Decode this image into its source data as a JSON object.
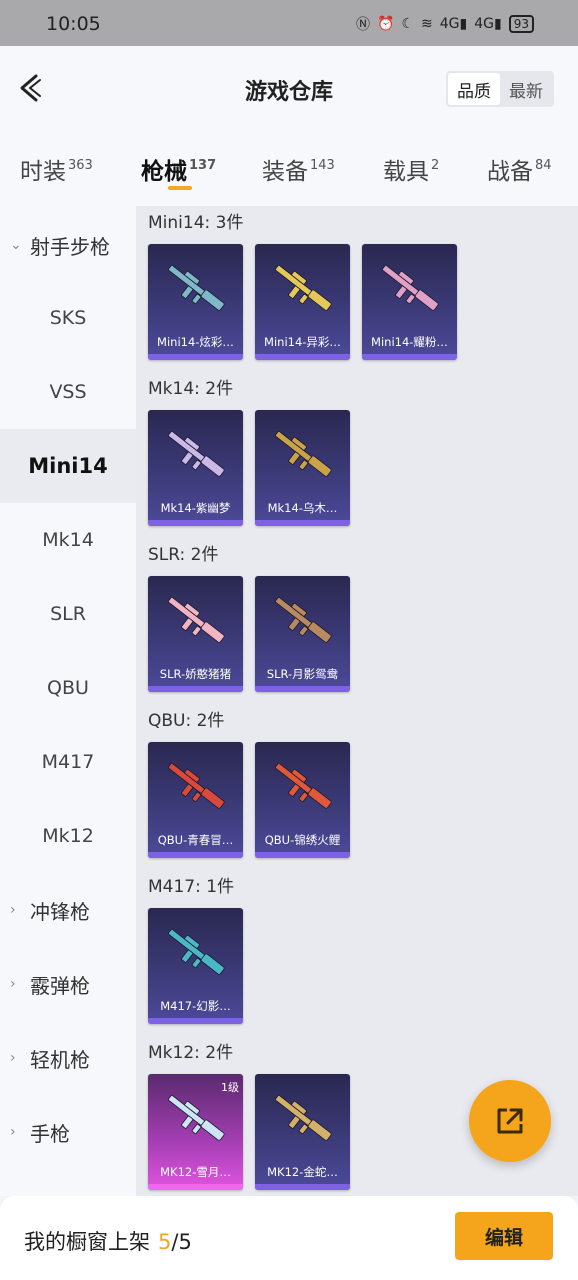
{
  "status_bar": {
    "time": "10:05",
    "network": "4G",
    "battery": "93"
  },
  "header": {
    "title": "游戏仓库",
    "sort_options": [
      "品质",
      "最新"
    ],
    "active_sort": "品质"
  },
  "tabs": [
    {
      "label": "时装",
      "count": "363"
    },
    {
      "label": "枪械",
      "count": "137",
      "active": true
    },
    {
      "label": "装备",
      "count": "143"
    },
    {
      "label": "载具",
      "count": "2"
    },
    {
      "label": "战备",
      "count": "84"
    }
  ],
  "sidebar": {
    "category_expanded": "射手步枪",
    "items": [
      "SKS",
      "VSS",
      "Mini14",
      "Mk14",
      "SLR",
      "QBU",
      "M417",
      "Mk12"
    ],
    "active_item": "Mini14",
    "collapsed_categories": [
      "冲锋枪",
      "霰弹枪",
      "轻机枪",
      "手枪"
    ]
  },
  "groups": [
    {
      "title": "Mini14: 3件",
      "items": [
        {
          "label": "Mini14-炫彩…",
          "color": "#7fb8c9"
        },
        {
          "label": "Mini14-异彩…",
          "color": "#e4c95a"
        },
        {
          "label": "Mini14-耀粉…",
          "color": "#e1a0c8"
        }
      ]
    },
    {
      "title": "Mk14: 2件",
      "items": [
        {
          "label": "Mk14-紫幽梦",
          "color": "#c9b8e8"
        },
        {
          "label": "Mk14-乌木…",
          "color": "#caa24a"
        }
      ]
    },
    {
      "title": "SLR: 2件",
      "items": [
        {
          "label": "SLR-娇憨猪猪",
          "color": "#f1b4c4"
        },
        {
          "label": "SLR-月影鸳鸯",
          "color": "#b88a62"
        }
      ]
    },
    {
      "title": "QBU: 2件",
      "items": [
        {
          "label": "QBU-青春冒…",
          "color": "#d94a3c"
        },
        {
          "label": "QBU-锦绣火鲤",
          "color": "#e0583c"
        }
      ]
    },
    {
      "title": "M417: 1件",
      "items": [
        {
          "label": "M417-幻影…",
          "color": "#4bb8c8"
        }
      ]
    },
    {
      "title": "Mk12: 2件",
      "items": [
        {
          "label": "MK12-雪月…",
          "color": "#cfe4f4",
          "level": "1级",
          "rarity": "pink"
        },
        {
          "label": "MK12-金蛇…",
          "color": "#d4b06a"
        }
      ]
    }
  ],
  "fab": {
    "icon": "share-external-icon"
  },
  "bottom_bar": {
    "label": "我的橱窗上架",
    "count": "5",
    "total": "/5",
    "edit_label": "编辑"
  },
  "colors": {
    "accent": "#f4a51c",
    "card_band": "#7d62e8"
  }
}
